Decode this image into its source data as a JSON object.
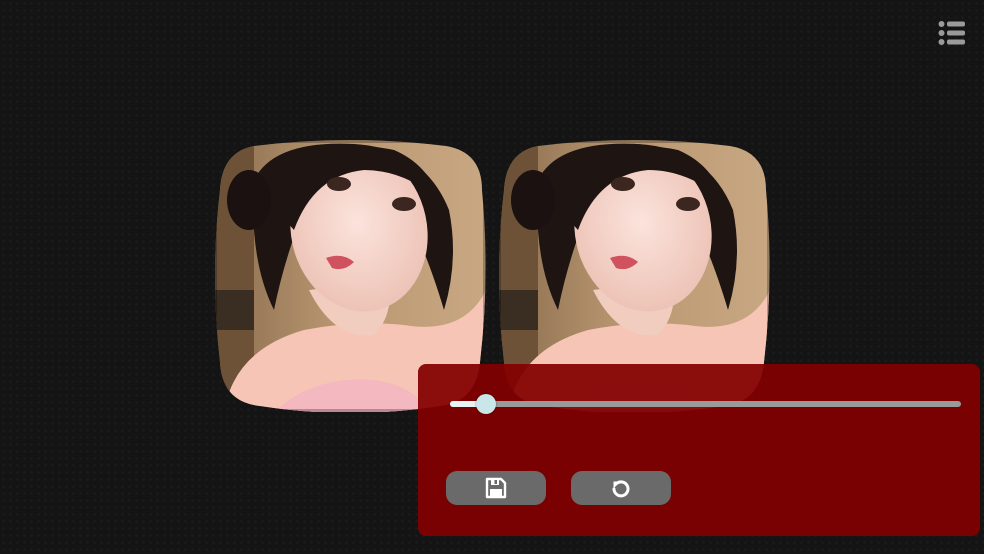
{
  "toolbar": {
    "menu_icon": "list-icon"
  },
  "viewer": {
    "mode": "stereoscopic-vr",
    "views": [
      {
        "name": "left-eye-view",
        "image": "portrait-photo"
      },
      {
        "name": "right-eye-view",
        "image": "portrait-photo"
      }
    ]
  },
  "controls": {
    "slider_value": 0.07,
    "save_icon": "floppy-disk-icon",
    "reset_icon": "rotate-ccw-icon"
  },
  "colors": {
    "background": "#141414",
    "panel": "#820000",
    "button": "#6a6a6a",
    "slider_thumb": "#c9e6e8",
    "slider_track": "#9a9a9a"
  }
}
